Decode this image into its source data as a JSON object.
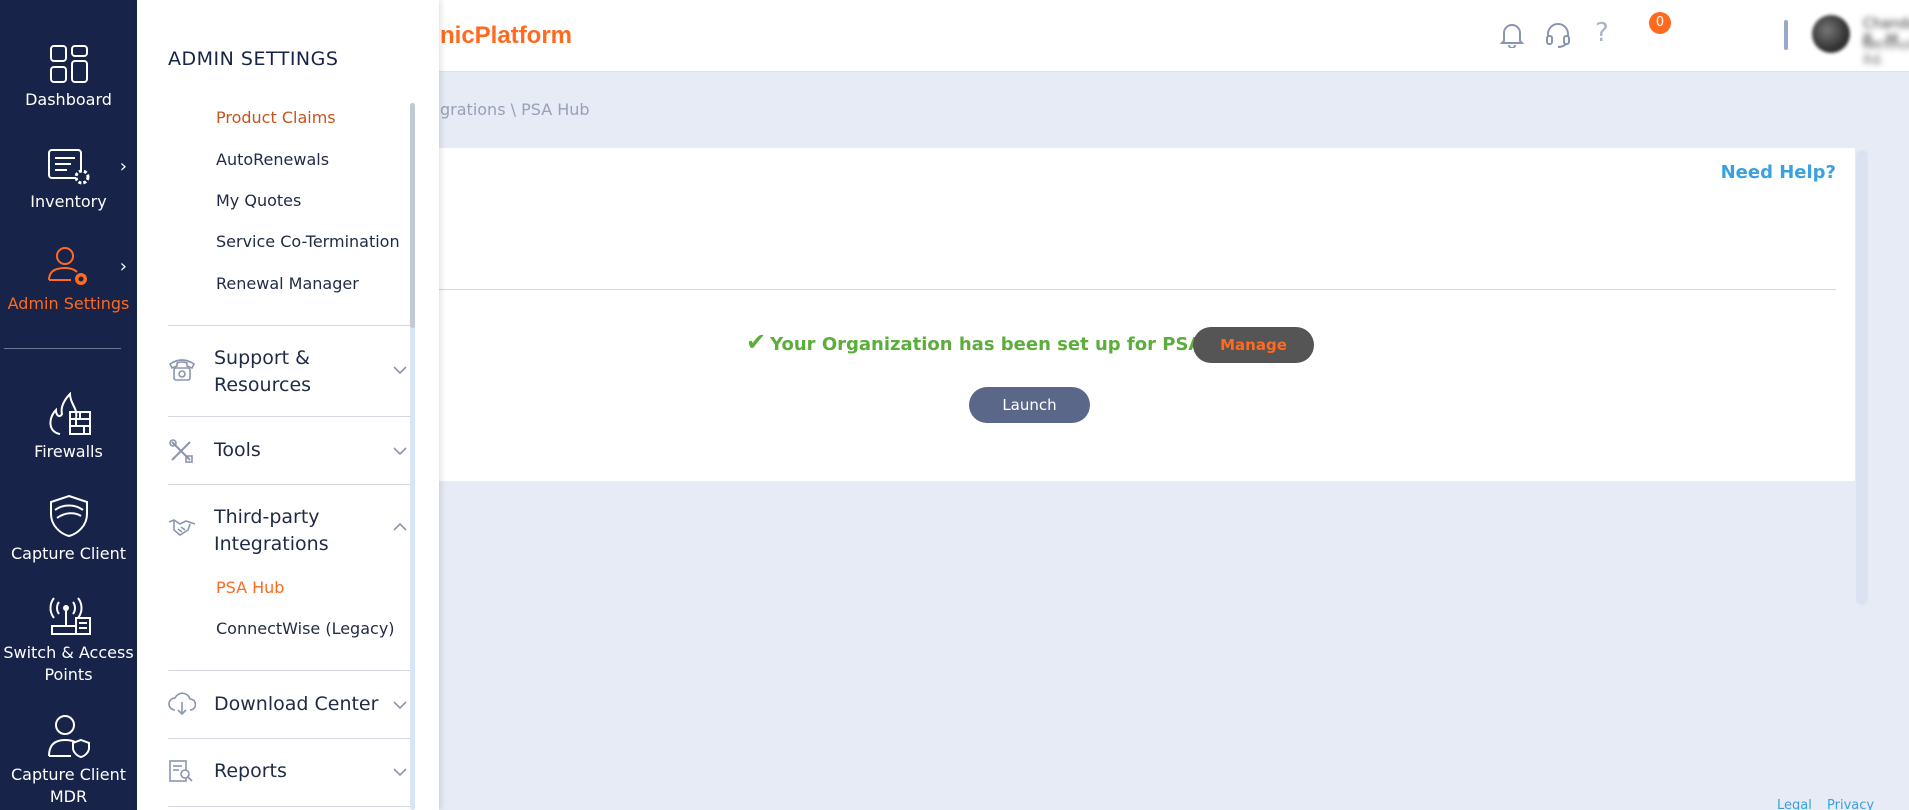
{
  "leftnav": {
    "items": [
      {
        "label": "Dashboard",
        "icon": "dashboard-icon"
      },
      {
        "label": "Inventory",
        "icon": "inventory-icon"
      },
      {
        "label": "Admin Settings",
        "icon": "admin-settings-icon"
      },
      {
        "label": "Firewalls",
        "icon": "firewall-icon"
      },
      {
        "label": "Capture Client",
        "icon": "capture-client-icon"
      },
      {
        "label": "Switch & Access Points",
        "icon": "switch-ap-icon"
      },
      {
        "label": "Capture Client MDR",
        "icon": "capture-client-mdr-icon"
      }
    ],
    "active": "Admin Settings",
    "accent": "#ff6a1f",
    "background": "#172348"
  },
  "header": {
    "brand": "nicPlatform",
    "notification_count": "0",
    "user_name": "Chandan B., M",
    "user_org": "technologi, ltd."
  },
  "breadcrumb": "grations \\ PSA Hub",
  "flyout": {
    "title": "ADMIN SETTINGS",
    "top_links": [
      "Product Claims",
      "AutoRenewals",
      "My Quotes",
      "Service Co-Termination",
      "Renewal Manager"
    ],
    "sections": [
      {
        "label_lines": [
          "Support &",
          "Resources"
        ],
        "icon": "support-phone-icon",
        "expanded": false
      },
      {
        "label_lines": [
          "Tools"
        ],
        "icon": "tools-icon",
        "expanded": false
      },
      {
        "label_lines": [
          "Third-party",
          "Integrations"
        ],
        "icon": "handshake-icon",
        "expanded": true,
        "children": [
          "PSA Hub",
          "ConnectWise (Legacy)"
        ]
      },
      {
        "label_lines": [
          "Download Center"
        ],
        "icon": "cloud-download-icon",
        "expanded": false
      },
      {
        "label_lines": [
          "Reports"
        ],
        "icon": "reports-icon",
        "expanded": false
      }
    ]
  },
  "main": {
    "need_help": "Need Help?",
    "status_message": "Your Organization has been set up for PSA Hub.",
    "manage_label": "Manage",
    "launch_label": "Launch"
  },
  "footer": {
    "legal": "Legal",
    "privacy": "Privacy"
  },
  "colors": {
    "success": "#5cad3c",
    "link": "#3aa0e0",
    "brand_orange": "#ff6a1f"
  }
}
